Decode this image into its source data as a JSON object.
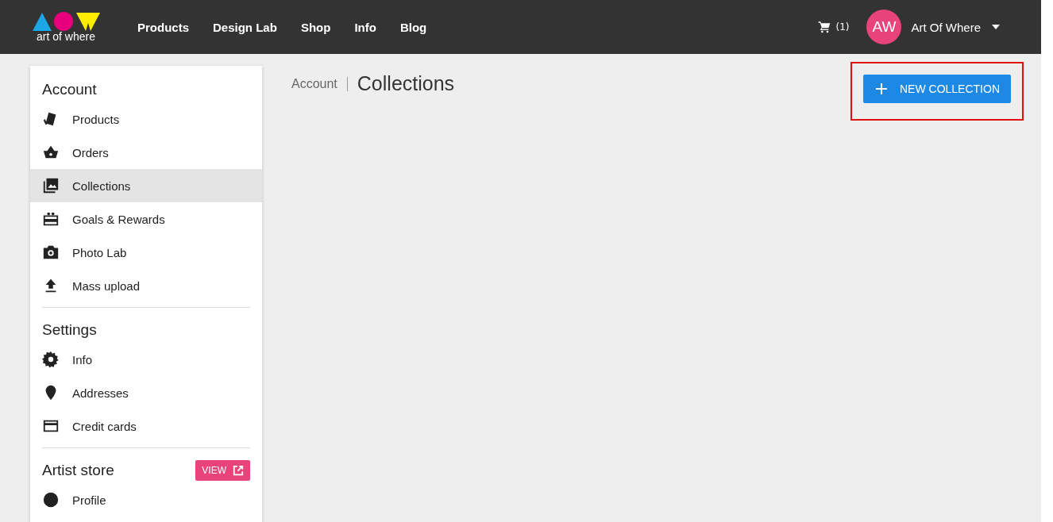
{
  "header": {
    "logo_text": "art of where",
    "nav": [
      "Products",
      "Design Lab",
      "Shop",
      "Info",
      "Blog"
    ],
    "cart_count": "(1)",
    "avatar_initials": "AW",
    "user_name": "Art Of Where"
  },
  "breadcrumb": {
    "parent": "Account",
    "current": "Collections"
  },
  "new_button": {
    "label": "NEW COLLECTION",
    "highlighted": true
  },
  "sidebar": {
    "sections": [
      {
        "title": "Account",
        "items": [
          {
            "label": "Products",
            "selected": false
          },
          {
            "label": "Orders",
            "selected": false
          },
          {
            "label": "Collections",
            "selected": true
          },
          {
            "label": "Goals & Rewards",
            "selected": false
          },
          {
            "label": "Photo Lab",
            "selected": false
          },
          {
            "label": "Mass upload",
            "selected": false
          }
        ]
      },
      {
        "title": "Settings",
        "items": [
          {
            "label": "Info",
            "selected": false
          },
          {
            "label": "Addresses",
            "selected": false
          },
          {
            "label": "Credit cards",
            "selected": false
          }
        ]
      },
      {
        "title": "Artist store",
        "action": "VIEW",
        "items": [
          {
            "label": "Profile",
            "selected": false
          }
        ]
      }
    ]
  }
}
